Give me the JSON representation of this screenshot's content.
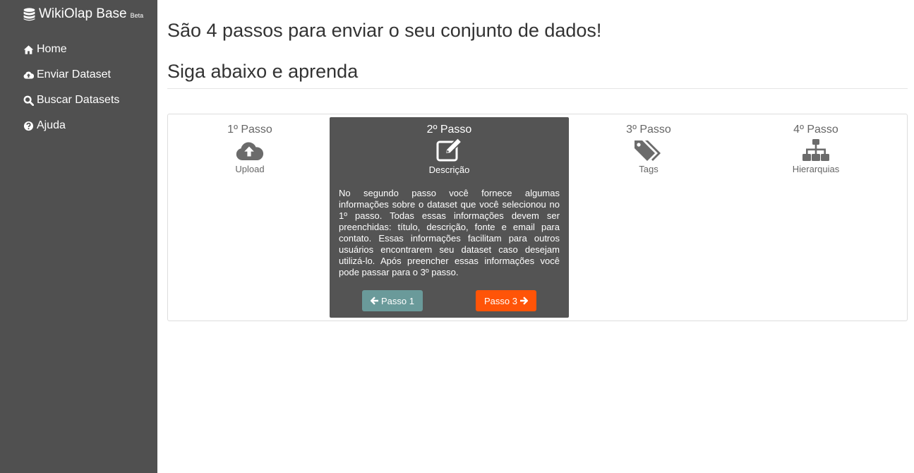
{
  "sidebar": {
    "brand": "WikiOlap Base",
    "brand_badge": "Beta",
    "brand_icon": "database-icon",
    "items": [
      {
        "label": "Home",
        "icon": "home-icon"
      },
      {
        "label": "Enviar Dataset",
        "icon": "cloud-upload-icon"
      },
      {
        "label": "Buscar Datasets",
        "icon": "search-icon"
      },
      {
        "label": "Ajuda",
        "icon": "question-circle-icon"
      }
    ]
  },
  "main": {
    "title": "São 4 passos para enviar o seu conjunto de dados!",
    "subtitle": "Siga abaixo e aprenda"
  },
  "steps": [
    {
      "title": "1º Passo",
      "caption": "Upload",
      "icon": "cloud-upload-icon"
    },
    {
      "title": "2º Passo",
      "caption": "Descrição",
      "icon": "edit-icon",
      "description": "No segundo passo você fornece algumas informações sobre o dataset que você selecionou no 1º passo. Todas essas informações devem ser preenchidas: título, descrição, fonte e email para contato. Essas informações facilitam para outros usuários encontrarem seu dataset caso desejam utilizá-lo. Após preencher essas informações você pode passar para o 3º passo."
    },
    {
      "title": "3º Passo",
      "caption": "Tags",
      "icon": "tags-icon"
    },
    {
      "title": "4º Passo",
      "caption": "Hierarquias",
      "icon": "sitemap-icon"
    }
  ],
  "buttons": {
    "prev_label": "Passo 1",
    "next_label": "Passo 3"
  },
  "colors": {
    "sidebar_bg": "#505050",
    "active_step_bg": "#545454",
    "prev_button": "#6a9a9a",
    "next_button": "#ff5408"
  }
}
